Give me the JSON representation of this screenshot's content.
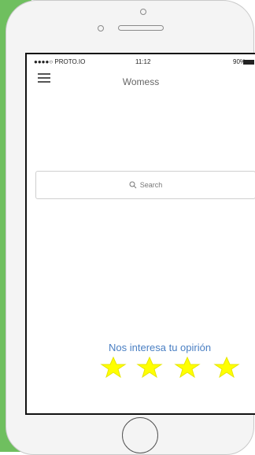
{
  "device": {
    "frame": "iPhone"
  },
  "status_bar": {
    "carrier": "●●●●○ PROTO.IO",
    "time": "11:12",
    "battery": "90%"
  },
  "header": {
    "title": "Womess",
    "menu_icon": "hamburger-icon"
  },
  "search": {
    "placeholder": "Search",
    "icon": "search-icon"
  },
  "feedback": {
    "prompt": "Nos interesa tu opirión",
    "rating_stars": 4,
    "star_color": "#ffff00"
  },
  "colors": {
    "accent_text": "#4a7fc3",
    "side_tab": "#6fbf5f"
  }
}
